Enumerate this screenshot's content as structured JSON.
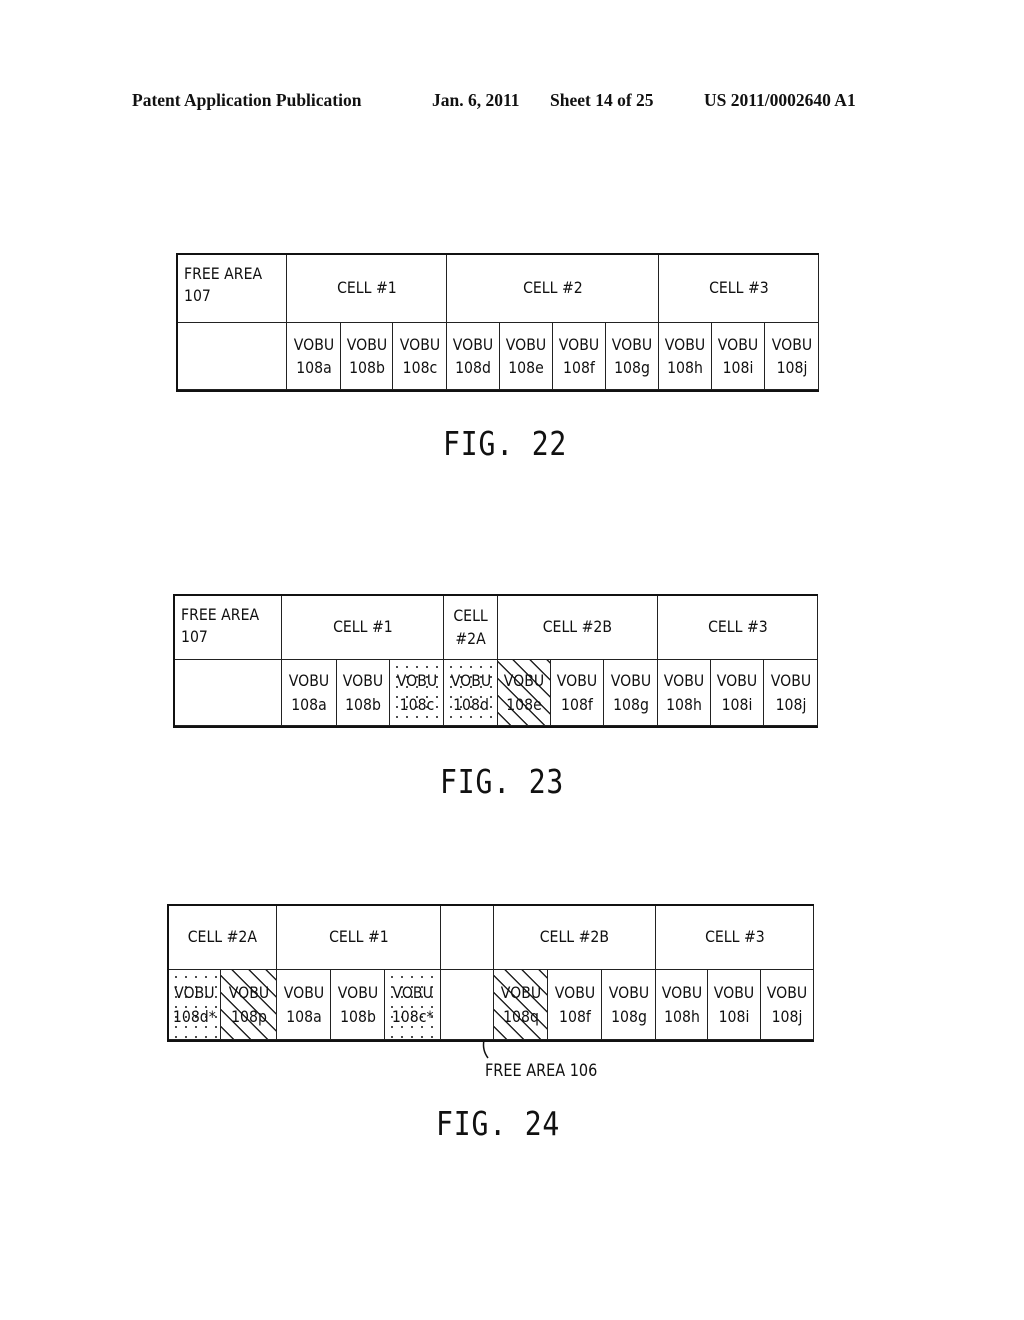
{
  "header": {
    "publication": "Patent Application Publication",
    "date": "Jan. 6, 2011",
    "sheet": "Sheet 14 of 25",
    "number": "US 2011/0002640 A1"
  },
  "fig22": {
    "caption": "FIG. 22",
    "top_row": [
      "FREE AREA\n107",
      "CELL #1",
      "CELL #2",
      "CELL #3"
    ],
    "bottom_row": [
      {
        "label": "",
        "pattern": "none"
      },
      {
        "label": "VOBU\n108a",
        "pattern": "none"
      },
      {
        "label": "VOBU\n108b",
        "pattern": "none"
      },
      {
        "label": "VOBU\n108c",
        "pattern": "none"
      },
      {
        "label": "VOBU\n108d",
        "pattern": "none"
      },
      {
        "label": "VOBU\n108e",
        "pattern": "none"
      },
      {
        "label": "VOBU\n108f",
        "pattern": "none"
      },
      {
        "label": "VOBU\n108g",
        "pattern": "none"
      },
      {
        "label": "VOBU\n108h",
        "pattern": "none"
      },
      {
        "label": "VOBU\n108i",
        "pattern": "none"
      },
      {
        "label": "VOBU\n108j",
        "pattern": "none"
      }
    ]
  },
  "fig23": {
    "caption": "FIG. 23",
    "top_row": [
      "FREE AREA\n107",
      "CELL #1",
      "CELL\n#2A",
      "CELL #2B",
      "CELL #3"
    ],
    "bottom_row": [
      {
        "label": "",
        "pattern": "none"
      },
      {
        "label": "VOBU\n108a",
        "pattern": "none"
      },
      {
        "label": "VOBU\n108b",
        "pattern": "none"
      },
      {
        "label": "VOBU\n108c",
        "pattern": "dots"
      },
      {
        "label": "VOBU\n108d",
        "pattern": "dots"
      },
      {
        "label": "VOBU\n108e",
        "pattern": "hatch"
      },
      {
        "label": "VOBU\n108f",
        "pattern": "none"
      },
      {
        "label": "VOBU\n108g",
        "pattern": "none"
      },
      {
        "label": "VOBU\n108h",
        "pattern": "none"
      },
      {
        "label": "VOBU\n108i",
        "pattern": "none"
      },
      {
        "label": "VOBU\n108j",
        "pattern": "none"
      }
    ]
  },
  "fig24": {
    "caption": "FIG. 24",
    "annotation": "FREE AREA 106",
    "top_row": [
      "CELL #2A",
      "CELL #1",
      "",
      "CELL #2B",
      "CELL #3"
    ],
    "bottom_row": [
      {
        "label": "VOBU\n108d*",
        "pattern": "dots"
      },
      {
        "label": "VOBU\n108p",
        "pattern": "hatch"
      },
      {
        "label": "VOBU\n108a",
        "pattern": "none"
      },
      {
        "label": "VOBU\n108b",
        "pattern": "none"
      },
      {
        "label": "VOBU\n108c*",
        "pattern": "dots"
      },
      {
        "label": "",
        "pattern": "none"
      },
      {
        "label": "VOBU\n108q",
        "pattern": "hatch"
      },
      {
        "label": "VOBU\n108f",
        "pattern": "none"
      },
      {
        "label": "VOBU\n108g",
        "pattern": "none"
      },
      {
        "label": "VOBU\n108h",
        "pattern": "none"
      },
      {
        "label": "VOBU\n108i",
        "pattern": "none"
      },
      {
        "label": "VOBU\n108j",
        "pattern": "none"
      }
    ]
  }
}
